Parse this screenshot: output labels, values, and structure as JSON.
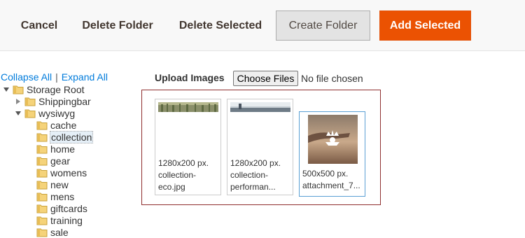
{
  "toolbar": {
    "cancel": "Cancel",
    "delete_folder": "Delete Folder",
    "delete_selected": "Delete Selected",
    "create_folder": "Create Folder",
    "add_selected": "Add Selected"
  },
  "tree": {
    "collapse_all": "Collapse All",
    "expand_all": "Expand All",
    "separator": "|",
    "root": "Storage Root",
    "shippingbar": "Shippingbar",
    "wysiwyg": "wysiwyg",
    "children": [
      "cache",
      "collection",
      "home",
      "gear",
      "womens",
      "new",
      "mens",
      "giftcards",
      "training",
      "sale"
    ],
    "selected": "collection"
  },
  "upload": {
    "label": "Upload Images",
    "choose_files": "Choose Files",
    "status": "No file chosen"
  },
  "images": [
    {
      "size": "1280x200 px.",
      "name_line1": "collection-",
      "name_line2": "eco.jpg",
      "selected": false
    },
    {
      "size": "1280x200 px.",
      "name_line1": "collection-",
      "name_line2": "performan...",
      "selected": false
    },
    {
      "size": "500x500 px.",
      "name_line1": "attachment_7...",
      "name_line2": "",
      "selected": true
    }
  ],
  "colors": {
    "primary_button": "#eb5202",
    "link": "#007bdb",
    "gallery_border": "#8f2f2f",
    "selected_card_border": "#5a9fd4"
  }
}
